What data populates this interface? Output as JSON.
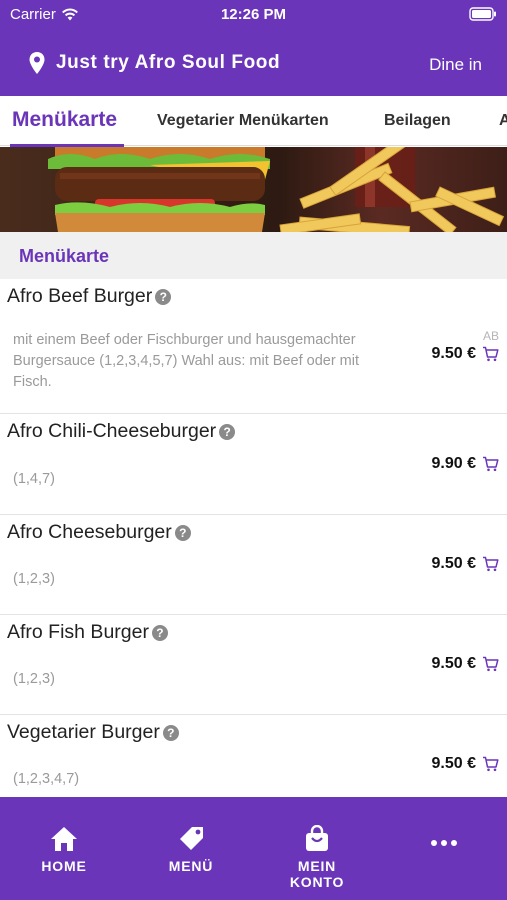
{
  "status": {
    "carrier": "Carrier",
    "time": "12:26 PM"
  },
  "header": {
    "restaurant": "Just try Afro Soul Food",
    "mode": "Dine in"
  },
  "tabs": [
    {
      "label": "Menükarte",
      "active": true
    },
    {
      "label": "Vegetarier Menükarten",
      "active": false
    },
    {
      "label": "Beilagen",
      "active": false
    },
    {
      "label": "A",
      "active": false
    }
  ],
  "section": {
    "title": "Menükarte"
  },
  "items": [
    {
      "name": "Afro Beef Burger",
      "description": "mit einem Beef oder Fischburger und hausgemachter Burgersauce (1,2,3,4,5,7) Wahl aus: mit Beef oder mit Fisch.",
      "price": "9.50 €",
      "price_prefix": "AB"
    },
    {
      "name": "Afro Chili-Cheeseburger",
      "description": "(1,4,7)",
      "price": "9.90 €"
    },
    {
      "name": "Afro Cheeseburger",
      "description": "(1,2,3)",
      "price": "9.50 €"
    },
    {
      "name": "Afro Fish Burger",
      "description": "(1,2,3)",
      "price": "9.50 €"
    },
    {
      "name": "Vegetarier Burger",
      "description": "(1,2,3,4,7)",
      "price": "9.50 €"
    }
  ],
  "nav": {
    "home": "HOME",
    "menu": "MENÜ",
    "account": "MEIN KONTO"
  },
  "colors": {
    "brand": "#6a35b8",
    "price": "#111111",
    "muted": "#9a9a9a"
  },
  "icons": [
    "wifi-icon",
    "battery-icon",
    "location-pin-icon",
    "info-icon",
    "cart-icon",
    "home-icon",
    "tag-icon",
    "bag-icon",
    "more-icon"
  ]
}
